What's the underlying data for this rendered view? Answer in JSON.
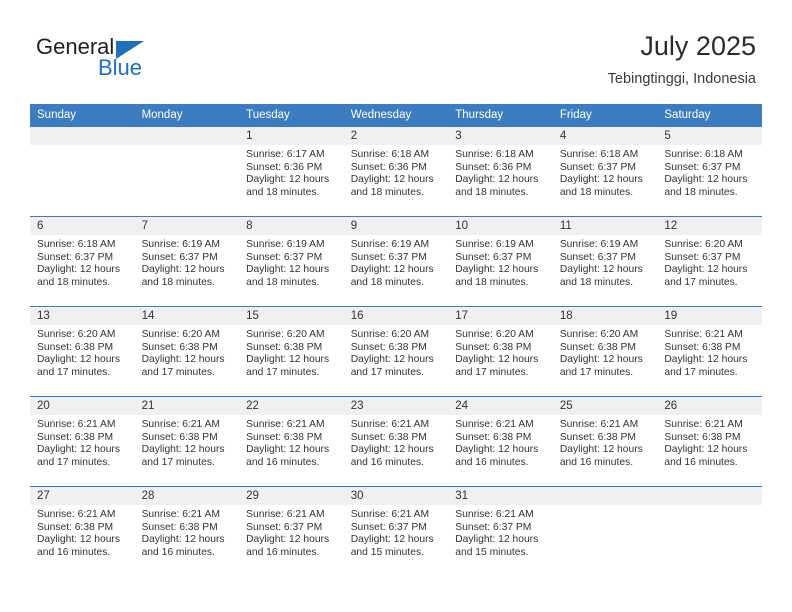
{
  "logo": {
    "word1": "General",
    "word2": "Blue",
    "triangle_color": "#1f6fbd",
    "text_color": "#231f20"
  },
  "header": {
    "title": "July 2025",
    "location": "Tebingtinggi, Indonesia"
  },
  "theme": {
    "header_band": "#3b7dc0",
    "daynum_band": "#f0f0f0",
    "text": "#333333"
  },
  "calendar": {
    "weekday_headers": [
      "Sunday",
      "Monday",
      "Tuesday",
      "Wednesday",
      "Thursday",
      "Friday",
      "Saturday"
    ],
    "weeks": [
      [
        {
          "day": "",
          "empty": true
        },
        {
          "day": "",
          "empty": true
        },
        {
          "day": "1",
          "sunrise": "Sunrise: 6:17 AM",
          "sunset": "Sunset: 6:36 PM",
          "daylight_line1": "Daylight: 12 hours",
          "daylight_line2": "and 18 minutes."
        },
        {
          "day": "2",
          "sunrise": "Sunrise: 6:18 AM",
          "sunset": "Sunset: 6:36 PM",
          "daylight_line1": "Daylight: 12 hours",
          "daylight_line2": "and 18 minutes."
        },
        {
          "day": "3",
          "sunrise": "Sunrise: 6:18 AM",
          "sunset": "Sunset: 6:36 PM",
          "daylight_line1": "Daylight: 12 hours",
          "daylight_line2": "and 18 minutes."
        },
        {
          "day": "4",
          "sunrise": "Sunrise: 6:18 AM",
          "sunset": "Sunset: 6:37 PM",
          "daylight_line1": "Daylight: 12 hours",
          "daylight_line2": "and 18 minutes."
        },
        {
          "day": "5",
          "sunrise": "Sunrise: 6:18 AM",
          "sunset": "Sunset: 6:37 PM",
          "daylight_line1": "Daylight: 12 hours",
          "daylight_line2": "and 18 minutes."
        }
      ],
      [
        {
          "day": "6",
          "sunrise": "Sunrise: 6:18 AM",
          "sunset": "Sunset: 6:37 PM",
          "daylight_line1": "Daylight: 12 hours",
          "daylight_line2": "and 18 minutes."
        },
        {
          "day": "7",
          "sunrise": "Sunrise: 6:19 AM",
          "sunset": "Sunset: 6:37 PM",
          "daylight_line1": "Daylight: 12 hours",
          "daylight_line2": "and 18 minutes."
        },
        {
          "day": "8",
          "sunrise": "Sunrise: 6:19 AM",
          "sunset": "Sunset: 6:37 PM",
          "daylight_line1": "Daylight: 12 hours",
          "daylight_line2": "and 18 minutes."
        },
        {
          "day": "9",
          "sunrise": "Sunrise: 6:19 AM",
          "sunset": "Sunset: 6:37 PM",
          "daylight_line1": "Daylight: 12 hours",
          "daylight_line2": "and 18 minutes."
        },
        {
          "day": "10",
          "sunrise": "Sunrise: 6:19 AM",
          "sunset": "Sunset: 6:37 PM",
          "daylight_line1": "Daylight: 12 hours",
          "daylight_line2": "and 18 minutes."
        },
        {
          "day": "11",
          "sunrise": "Sunrise: 6:19 AM",
          "sunset": "Sunset: 6:37 PM",
          "daylight_line1": "Daylight: 12 hours",
          "daylight_line2": "and 18 minutes."
        },
        {
          "day": "12",
          "sunrise": "Sunrise: 6:20 AM",
          "sunset": "Sunset: 6:37 PM",
          "daylight_line1": "Daylight: 12 hours",
          "daylight_line2": "and 17 minutes."
        }
      ],
      [
        {
          "day": "13",
          "sunrise": "Sunrise: 6:20 AM",
          "sunset": "Sunset: 6:38 PM",
          "daylight_line1": "Daylight: 12 hours",
          "daylight_line2": "and 17 minutes."
        },
        {
          "day": "14",
          "sunrise": "Sunrise: 6:20 AM",
          "sunset": "Sunset: 6:38 PM",
          "daylight_line1": "Daylight: 12 hours",
          "daylight_line2": "and 17 minutes."
        },
        {
          "day": "15",
          "sunrise": "Sunrise: 6:20 AM",
          "sunset": "Sunset: 6:38 PM",
          "daylight_line1": "Daylight: 12 hours",
          "daylight_line2": "and 17 minutes."
        },
        {
          "day": "16",
          "sunrise": "Sunrise: 6:20 AM",
          "sunset": "Sunset: 6:38 PM",
          "daylight_line1": "Daylight: 12 hours",
          "daylight_line2": "and 17 minutes."
        },
        {
          "day": "17",
          "sunrise": "Sunrise: 6:20 AM",
          "sunset": "Sunset: 6:38 PM",
          "daylight_line1": "Daylight: 12 hours",
          "daylight_line2": "and 17 minutes."
        },
        {
          "day": "18",
          "sunrise": "Sunrise: 6:20 AM",
          "sunset": "Sunset: 6:38 PM",
          "daylight_line1": "Daylight: 12 hours",
          "daylight_line2": "and 17 minutes."
        },
        {
          "day": "19",
          "sunrise": "Sunrise: 6:21 AM",
          "sunset": "Sunset: 6:38 PM",
          "daylight_line1": "Daylight: 12 hours",
          "daylight_line2": "and 17 minutes."
        }
      ],
      [
        {
          "day": "20",
          "sunrise": "Sunrise: 6:21 AM",
          "sunset": "Sunset: 6:38 PM",
          "daylight_line1": "Daylight: 12 hours",
          "daylight_line2": "and 17 minutes."
        },
        {
          "day": "21",
          "sunrise": "Sunrise: 6:21 AM",
          "sunset": "Sunset: 6:38 PM",
          "daylight_line1": "Daylight: 12 hours",
          "daylight_line2": "and 17 minutes."
        },
        {
          "day": "22",
          "sunrise": "Sunrise: 6:21 AM",
          "sunset": "Sunset: 6:38 PM",
          "daylight_line1": "Daylight: 12 hours",
          "daylight_line2": "and 16 minutes."
        },
        {
          "day": "23",
          "sunrise": "Sunrise: 6:21 AM",
          "sunset": "Sunset: 6:38 PM",
          "daylight_line1": "Daylight: 12 hours",
          "daylight_line2": "and 16 minutes."
        },
        {
          "day": "24",
          "sunrise": "Sunrise: 6:21 AM",
          "sunset": "Sunset: 6:38 PM",
          "daylight_line1": "Daylight: 12 hours",
          "daylight_line2": "and 16 minutes."
        },
        {
          "day": "25",
          "sunrise": "Sunrise: 6:21 AM",
          "sunset": "Sunset: 6:38 PM",
          "daylight_line1": "Daylight: 12 hours",
          "daylight_line2": "and 16 minutes."
        },
        {
          "day": "26",
          "sunrise": "Sunrise: 6:21 AM",
          "sunset": "Sunset: 6:38 PM",
          "daylight_line1": "Daylight: 12 hours",
          "daylight_line2": "and 16 minutes."
        }
      ],
      [
        {
          "day": "27",
          "sunrise": "Sunrise: 6:21 AM",
          "sunset": "Sunset: 6:38 PM",
          "daylight_line1": "Daylight: 12 hours",
          "daylight_line2": "and 16 minutes."
        },
        {
          "day": "28",
          "sunrise": "Sunrise: 6:21 AM",
          "sunset": "Sunset: 6:38 PM",
          "daylight_line1": "Daylight: 12 hours",
          "daylight_line2": "and 16 minutes."
        },
        {
          "day": "29",
          "sunrise": "Sunrise: 6:21 AM",
          "sunset": "Sunset: 6:37 PM",
          "daylight_line1": "Daylight: 12 hours",
          "daylight_line2": "and 16 minutes."
        },
        {
          "day": "30",
          "sunrise": "Sunrise: 6:21 AM",
          "sunset": "Sunset: 6:37 PM",
          "daylight_line1": "Daylight: 12 hours",
          "daylight_line2": "and 15 minutes."
        },
        {
          "day": "31",
          "sunrise": "Sunrise: 6:21 AM",
          "sunset": "Sunset: 6:37 PM",
          "daylight_line1": "Daylight: 12 hours",
          "daylight_line2": "and 15 minutes."
        },
        {
          "day": "",
          "empty": true
        },
        {
          "day": "",
          "empty": true
        }
      ]
    ]
  }
}
